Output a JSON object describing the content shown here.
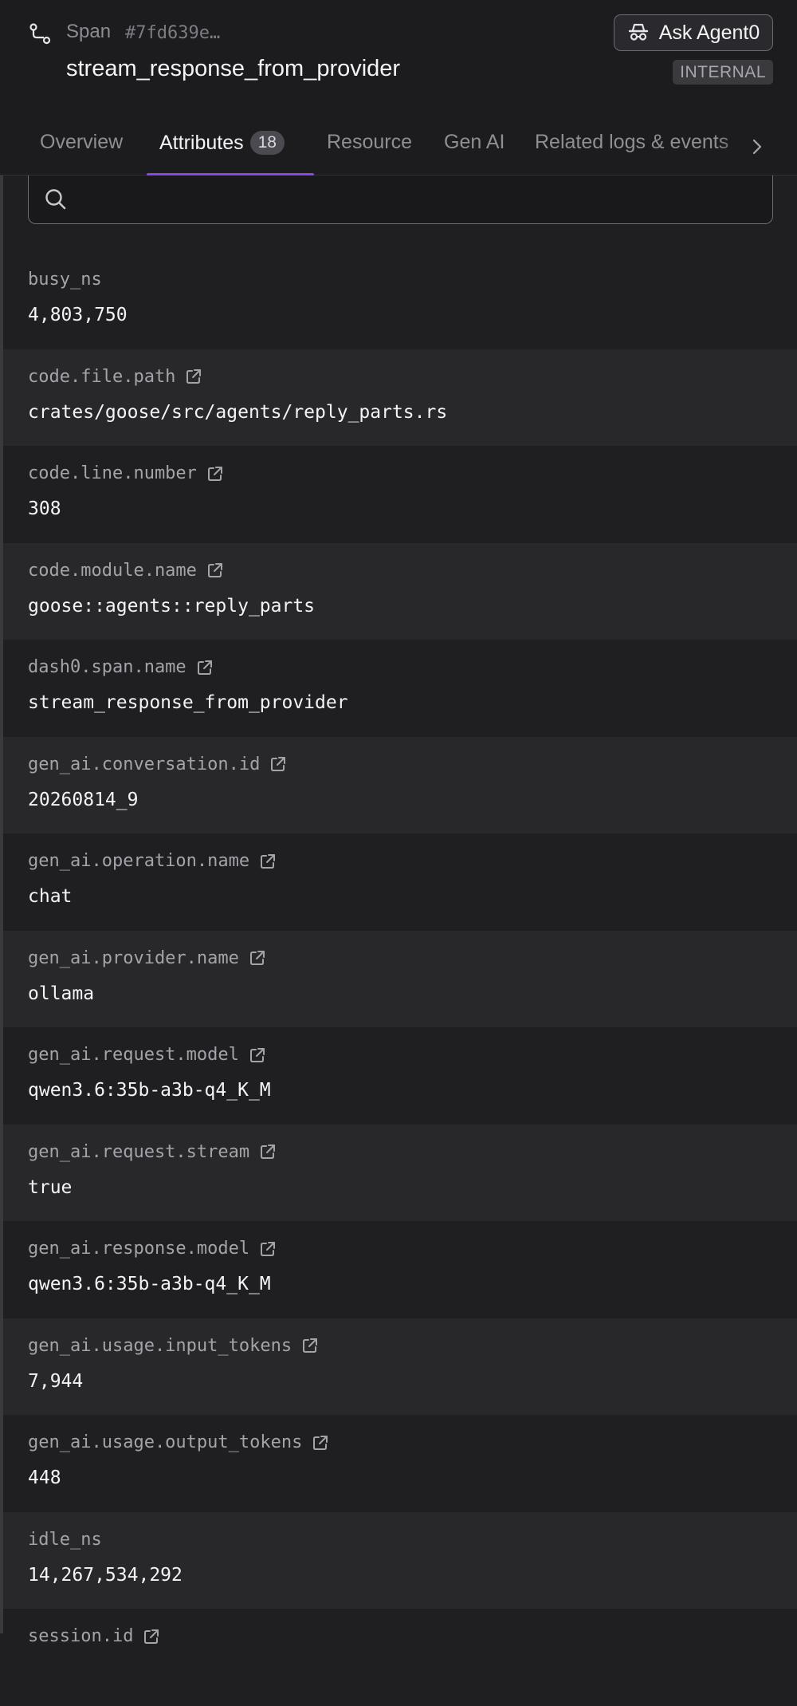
{
  "header": {
    "span_label": "Span",
    "span_id": "#7fd639e…",
    "title": "stream_response_from_provider",
    "ask_button_label": "Ask Agent0",
    "kind_badge": "INTERNAL"
  },
  "tabs": [
    {
      "label": "Overview",
      "active": false
    },
    {
      "label": "Attributes",
      "count": "18",
      "active": true
    },
    {
      "label": "Resource",
      "active": false
    },
    {
      "label": "Gen AI",
      "active": false
    },
    {
      "label": "Related logs & events",
      "active": false
    }
  ],
  "search": {
    "value": "",
    "placeholder": ""
  },
  "attributes": [
    {
      "key": "busy_ns",
      "value": "4,803,750",
      "external_link": false
    },
    {
      "key": "code.file.path",
      "value": "crates/goose/src/agents/reply_parts.rs",
      "external_link": true
    },
    {
      "key": "code.line.number",
      "value": "308",
      "external_link": true
    },
    {
      "key": "code.module.name",
      "value": "goose::agents::reply_parts",
      "external_link": true
    },
    {
      "key": "dash0.span.name",
      "value": "stream_response_from_provider",
      "external_link": true
    },
    {
      "key": "gen_ai.conversation.id",
      "value": "20260814_9",
      "external_link": true
    },
    {
      "key": "gen_ai.operation.name",
      "value": "chat",
      "external_link": true
    },
    {
      "key": "gen_ai.provider.name",
      "value": "ollama",
      "external_link": true
    },
    {
      "key": "gen_ai.request.model",
      "value": "qwen3.6:35b-a3b-q4_K_M",
      "external_link": true
    },
    {
      "key": "gen_ai.request.stream",
      "value": "true",
      "external_link": true
    },
    {
      "key": "gen_ai.response.model",
      "value": "qwen3.6:35b-a3b-q4_K_M",
      "external_link": true
    },
    {
      "key": "gen_ai.usage.input_tokens",
      "value": "7,944",
      "external_link": true
    },
    {
      "key": "gen_ai.usage.output_tokens",
      "value": "448",
      "external_link": true
    },
    {
      "key": "idle_ns",
      "value": "14,267,534,292",
      "external_link": false
    },
    {
      "key": "session.id",
      "value": "",
      "external_link": true
    }
  ],
  "colors": {
    "background": "#1f1f22",
    "row_alt": "#28282b",
    "accent": "#8b45f0",
    "text_primary": "#f4f4f6",
    "text_muted": "#a3a3a9"
  },
  "icons": {
    "span": "span-route-icon",
    "agent": "agent-spy-icon",
    "search": "search-icon",
    "external": "external-link-icon",
    "scroll": "chevron-right-icon"
  }
}
